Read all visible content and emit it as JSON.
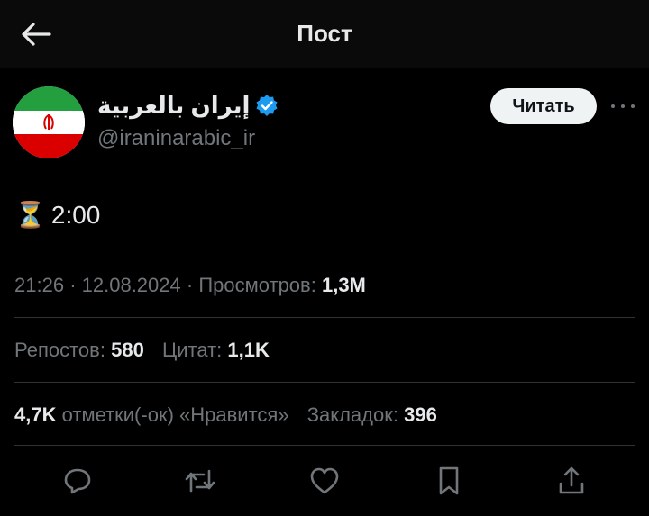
{
  "header": {
    "title": "Пост"
  },
  "author": {
    "name": "إيران بالعربية",
    "handle": "@iraninarabic_ir",
    "verified": true,
    "read_label": "Читать"
  },
  "tweet": {
    "emoji": "⏳",
    "text": "2:00"
  },
  "meta": {
    "time": "21:26",
    "date": "12.08.2024",
    "views_label": "Просмотров:",
    "views_value": "1,3M"
  },
  "stats": {
    "reposts_label": "Репостов:",
    "reposts_value": "580",
    "quotes_label": "Цитат:",
    "quotes_value": "1,1K",
    "likes_value": "4,7K",
    "likes_label": "отметки(-ок) «Нравится»",
    "bookmarks_label": "Закладок:",
    "bookmarks_value": "396"
  },
  "icons": [
    "back-arrow-icon",
    "verified-badge-icon",
    "more-icon",
    "reply-icon",
    "repost-icon",
    "like-icon",
    "bookmark-icon",
    "share-icon"
  ],
  "colors": {
    "background": "#000000",
    "text": "#e7e9ea",
    "muted": "#71767b",
    "verified": "#1d9bf0",
    "divider": "#2f3336"
  }
}
